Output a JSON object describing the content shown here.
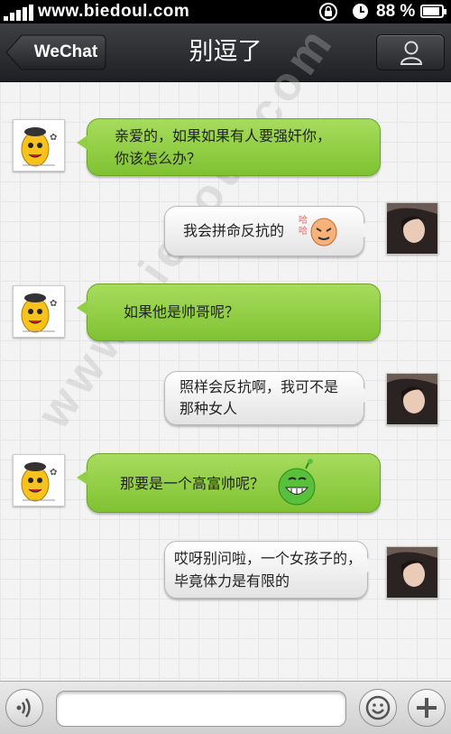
{
  "status_bar": {
    "site": "www.biedoul.com",
    "battery_text": "88 %",
    "battery_level": 0.88
  },
  "nav": {
    "back_label": "WeChat",
    "title": "别逗了",
    "back_icon": "back-arrow-icon",
    "profile_icon": "person-icon"
  },
  "watermark": "www.biedoul.com",
  "messages": [
    {
      "side": "left",
      "avatar": "bean-cartoon-avatar",
      "line1": "亲爱的，如果如果有人要强奸你，",
      "line2": "你该怎么办？"
    },
    {
      "side": "right",
      "avatar": "girl-photo-avatar",
      "line1": "我会拼命反抗的",
      "sticker": "angry-face-sticker"
    },
    {
      "side": "left",
      "avatar": "bean-cartoon-avatar",
      "line1": "如果他是帅哥呢？"
    },
    {
      "side": "right",
      "avatar": "girl-photo-avatar",
      "line1": "照样会反抗啊，我可不是",
      "line2": "那种女人"
    },
    {
      "side": "left",
      "avatar": "bean-cartoon-avatar",
      "line1": "那要是一个高富帅呢？",
      "sticker": "green-grin-sticker"
    },
    {
      "side": "right",
      "avatar": "girl-photo-avatar",
      "line1": "哎呀别问啦，一个女孩子的，",
      "line2": "毕竟体力是有限的"
    }
  ],
  "input_bar": {
    "voice_icon": "voice-icon",
    "emoji_icon": "smiley-icon",
    "plus_icon": "plus-icon",
    "placeholder": ""
  },
  "colors": {
    "green_bubble": "#8fcc43",
    "gray_bubble": "#efefef",
    "nav_bg": "#2c2d31"
  }
}
